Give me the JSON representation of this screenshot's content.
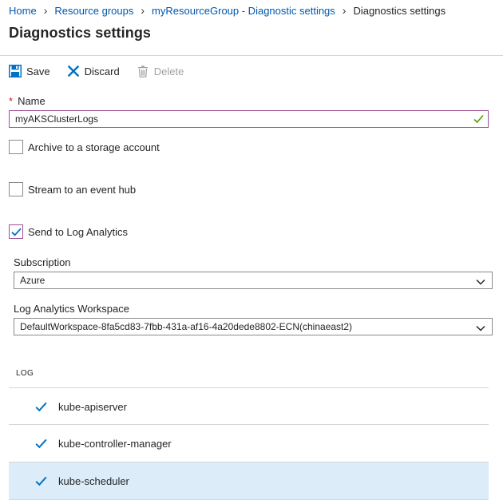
{
  "breadcrumb": {
    "items": [
      "Home",
      "Resource groups",
      "myResourceGroup - Diagnostic settings"
    ],
    "current": "Diagnostics settings"
  },
  "page": {
    "title": "Diagnostics settings"
  },
  "toolbar": {
    "save_label": "Save",
    "discard_label": "Discard",
    "delete_label": "Delete"
  },
  "form": {
    "name_label": "Name",
    "name_value": "myAKSClusterLogs",
    "archive_label": "Archive to a storage account",
    "archive_checked": false,
    "stream_label": "Stream to an event hub",
    "stream_checked": false,
    "log_analytics_label": "Send to Log Analytics",
    "log_analytics_checked": true,
    "subscription_label": "Subscription",
    "subscription_value": "Azure",
    "workspace_label": "Log Analytics Workspace",
    "workspace_value": "DefaultWorkspace-8fa5cd83-7fbb-431a-af16-4a20dede8802-ECN(chinaeast2)"
  },
  "logs": {
    "header": "LOG",
    "items": [
      {
        "label": "kube-apiserver",
        "checked": true
      },
      {
        "label": "kube-controller-manager",
        "checked": true
      },
      {
        "label": "kube-scheduler",
        "checked": true
      }
    ]
  },
  "colors": {
    "link": "#0058ad",
    "accent_check": "#9b4f96",
    "checkmark_blue": "#0072c6",
    "selected_row": "#dcecf9",
    "valid_green": "#57a300",
    "required_star": "#e00b1c"
  }
}
